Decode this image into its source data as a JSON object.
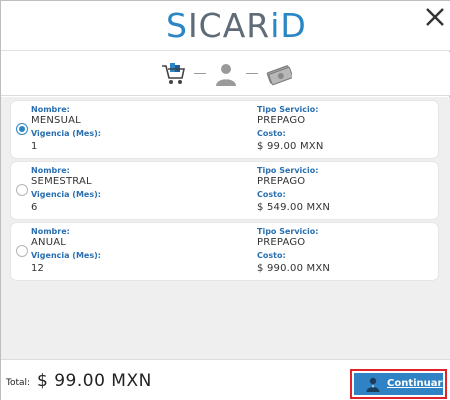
{
  "header": {
    "logo_s": "S",
    "logo_rest": "ICAR",
    "logo_i": "iD",
    "close_icon": "close-icon"
  },
  "steps": [
    {
      "icon": "shopping-cart-icon"
    },
    {
      "icon": "user-icon"
    },
    {
      "icon": "money-icon"
    }
  ],
  "labels": {
    "nombre": "Nombre:",
    "vigencia": "Vigencia (Mes):",
    "tipo_servicio": "Tipo Servicio:",
    "costo": "Costo:"
  },
  "plans": [
    {
      "nombre": "MENSUAL",
      "vigencia": "1",
      "tipo_servicio": "PREPAGO",
      "costo": "$ 99.00 MXN",
      "selected": true
    },
    {
      "nombre": "SEMESTRAL",
      "vigencia": "6",
      "tipo_servicio": "PREPAGO",
      "costo": "$ 549.00 MXN",
      "selected": false
    },
    {
      "nombre": "ANUAL",
      "vigencia": "12",
      "tipo_servicio": "PREPAGO",
      "costo": "$ 990.00 MXN",
      "selected": false
    }
  ],
  "footer": {
    "total_label": "Total:",
    "total_value": "$ 99.00 MXN",
    "continue_label": "Continuar"
  },
  "colors": {
    "accent": "#2b86c5",
    "button_bg": "#2f82c4",
    "highlight_border": "#e0242a",
    "content_bg": "#efefef"
  }
}
